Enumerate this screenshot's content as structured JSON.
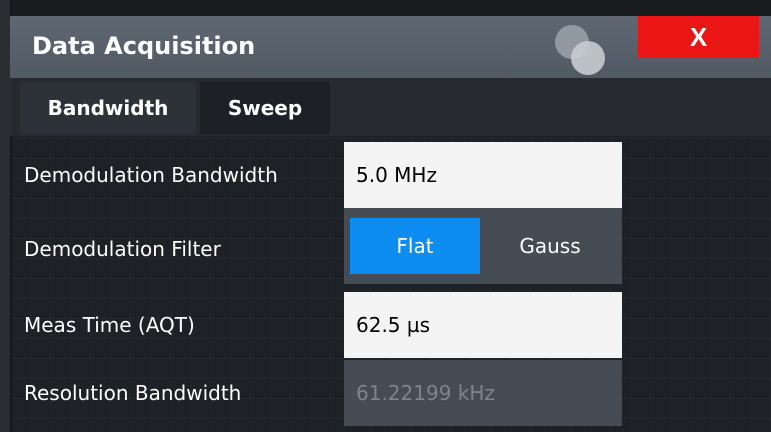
{
  "window": {
    "title": "Data Acquisition",
    "close_label": "X"
  },
  "tabs": [
    {
      "label": "Bandwidth"
    },
    {
      "label": "Sweep"
    }
  ],
  "fields": {
    "demod_bw": {
      "label": "Demodulation Bandwidth",
      "value": "5.0 MHz"
    },
    "demod_filter": {
      "label": "Demodulation Filter",
      "options": [
        "Flat",
        "Gauss"
      ],
      "selected": "Flat"
    },
    "meas_time": {
      "label": "Meas Time (AQT)",
      "value": "62.5 µs"
    },
    "res_bw": {
      "label": "Resolution Bandwidth",
      "value": "61.22199 kHz",
      "enabled": false
    }
  },
  "colors": {
    "accent": "#0d8cf1",
    "close": "#ec1515",
    "titlebar": "#5f6872",
    "background": "#1e2125"
  }
}
